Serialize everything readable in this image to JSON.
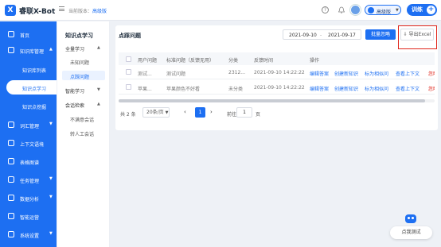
{
  "header": {
    "logo_letter": "X",
    "app_name": "睿联X-Bot",
    "version_label": "当前版本：",
    "version_value": "高级版",
    "help_glyph": "?",
    "edition": "高级版",
    "train_label": "训练",
    "train_plus": "+"
  },
  "nav": {
    "items": [
      {
        "label": "首页",
        "icon": "home-icon"
      },
      {
        "label": "知识库管理",
        "icon": "book-icon"
      },
      {
        "label": "知识库列表",
        "icon": ""
      },
      {
        "label": "知识点学习",
        "icon": ""
      },
      {
        "label": "知识点挖掘",
        "icon": ""
      },
      {
        "label": "词汇管理",
        "icon": "vocab-icon"
      },
      {
        "label": "上下文语境",
        "icon": "context-icon"
      },
      {
        "label": "表格图谱",
        "icon": "table-icon"
      },
      {
        "label": "任务管理",
        "icon": "task-icon"
      },
      {
        "label": "数据分析",
        "icon": "chart-icon"
      },
      {
        "label": "智能运营",
        "icon": "ops-icon"
      },
      {
        "label": "系统设置",
        "icon": "settings-icon"
      }
    ]
  },
  "subnav": {
    "title": "知识点学习",
    "groups": [
      {
        "label": "全量学习",
        "items": [
          "未知问题",
          "点踩问题"
        ]
      },
      {
        "label": "智能学习",
        "items": []
      },
      {
        "label": "会话检索",
        "items": [
          "不满意会话",
          "转人工会话"
        ]
      }
    ]
  },
  "main": {
    "title": "点踩问题",
    "date_start": "2021-09-10",
    "date_sep": "-",
    "date_end": "2021-09-17",
    "batch_button": "批量忽略",
    "export_button": "导出Excel",
    "columns": [
      "用户问题",
      "标准问题（反馈无用）",
      "分类",
      "反馈时间",
      "操作"
    ],
    "rows": [
      {
        "user_q": "测试...",
        "std_q": "测试问题",
        "category": "2312...",
        "time": "2021-09-10 14:22:22"
      },
      {
        "user_q": "苹果...",
        "std_q": "苹果颜色不好看",
        "category": "未分类",
        "time": "2021-09-10 14:22:22"
      }
    ],
    "actions": [
      "编辑答案",
      "创建新知识",
      "标为相似问",
      "查看上下文",
      "忽略"
    ],
    "pager": {
      "total": "共 2 条",
      "page_size": "20条/页",
      "prev": "‹",
      "current": "1",
      "next": "›",
      "goto": "前往",
      "goto_value": "1",
      "suffix": "页"
    }
  },
  "bot": {
    "label": "点我测试"
  },
  "colors": {
    "primary": "#1d6ff2",
    "danger": "#e0241a"
  }
}
